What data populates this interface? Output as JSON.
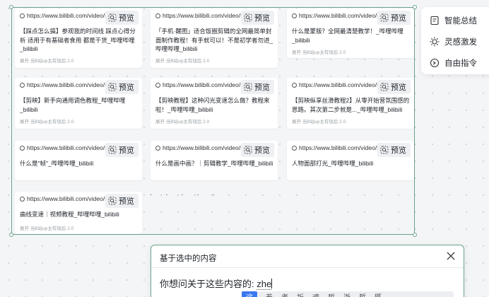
{
  "cards": [
    {
      "url": "https://www.bilibili.com/video/BV",
      "preview": "预览",
      "title": "【踩点怎么搞】参观我的时间线 踩点心得分析 适用于有基础者食用 都是干货_哔哩哔哩_bilibili",
      "meta": "展开  当B站up主有钱后 2.0"
    },
    {
      "url": "https://www.bilibili.com/video/BV",
      "preview": "预览",
      "title": "「手机·醒图」适合饭圈剪辑的全网最简单封面制作教程！有手就可以！不是初学者勿进_哔哩哔哩_bilibili",
      "meta": "展开  当B站up主有钱后 2.0"
    },
    {
      "url": "https://www.bilibili.com/video/BV",
      "preview": "预览",
      "title": "什么是蒙版？全网最清楚教学！_哔哩哔哩_bilibili",
      "meta": "展开  当B站up主有钱后 2.0"
    },
    {
      "url": "https://www.bilibili.com/video/BV",
      "preview": "预览",
      "title": "【剪映】新手向通用调色教程_哔哩哔哩_bilibili",
      "meta": "展开  当B站up主有钱后 2.0"
    },
    {
      "url": "https://www.bilibili.com/video/BV",
      "preview": "预览",
      "title": "【剪映教程】这种闪光变速怎么做？教程来啦！_哔哩哔哩_bilibili",
      "meta": "展开  当B站up主有钱后 2.0"
    },
    {
      "url": "https://www.bilibili.com/video/BV",
      "preview": "预览",
      "title": "【剪映纵享丝滑教程2】从零开始营氛围感的思路。其次第二步就是..._哔哩哔哩_bilibili",
      "meta": "展开  当B站up主有钱后 2.0"
    },
    {
      "url": "https://www.bilibili.com/video/BV",
      "preview": "预览",
      "title": "什么是\"帧\"_哔哩哔哩_bilibili",
      "meta": ""
    },
    {
      "url": "https://www.bilibili.com/video/BV",
      "preview": "预览",
      "title": "什么是画中画？｜剪辑教学_哔哩哔哩_bilibili",
      "meta": ""
    },
    {
      "url": "https://www.bilibili.com/video/BV",
      "preview": "预览",
      "title": "人物面部打光_哔哩哔哩_bilibili",
      "meta": ""
    },
    {
      "url": "https://www.bilibili.com/video/BV",
      "preview": "预览",
      "title": "曲线变速｜视频教程_哔哩哔哩_bilibili",
      "meta": "展开  当B站up主有钱后 2.0"
    }
  ],
  "side_menu": {
    "items": [
      {
        "label": "智能总结",
        "icon": "summary-icon"
      },
      {
        "label": "灵感激发",
        "icon": "inspiration-icon"
      },
      {
        "label": "自由指令",
        "icon": "command-icon"
      }
    ]
  },
  "dialog": {
    "title": "基于选中的内容",
    "prompt": "你想问关于这些内容的:",
    "query": "zhe"
  },
  "ime": {
    "candidates": [
      "这",
      "着",
      "者",
      "折",
      "遮",
      "哲",
      "浙",
      "蜇",
      "辄"
    ]
  },
  "colors": {
    "selection": "#6aa38c",
    "ime_active": "#3c78f0"
  }
}
